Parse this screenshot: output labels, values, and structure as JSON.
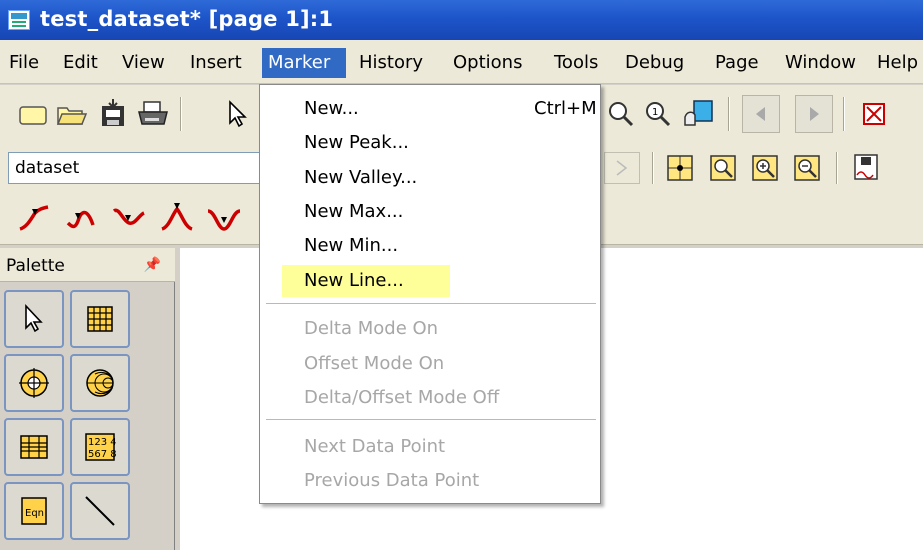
{
  "window": {
    "title": "test_dataset* [page 1]:1"
  },
  "menubar": {
    "items": [
      "File",
      "Edit",
      "View",
      "Insert",
      "Marker",
      "History",
      "Options",
      "Tools",
      "Debug",
      "Page",
      "Window",
      "Help"
    ],
    "active": "Marker"
  },
  "toolbar": {
    "dataset_value": "dataset"
  },
  "palette": {
    "title": "Palette"
  },
  "marker_menu": {
    "items": [
      {
        "label": "New...",
        "shortcut": "Ctrl+M",
        "enabled": true
      },
      {
        "label": "New Peak...",
        "enabled": true
      },
      {
        "label": "New Valley...",
        "enabled": true
      },
      {
        "label": "New Max...",
        "enabled": true
      },
      {
        "label": "New Min...",
        "enabled": true
      },
      {
        "label": "New Line...",
        "enabled": true,
        "highlighted": true
      },
      {
        "label": "Delta Mode On",
        "enabled": false
      },
      {
        "label": "Offset Mode On",
        "enabled": false
      },
      {
        "label": "Delta/Offset Mode Off",
        "enabled": false
      },
      {
        "label": "Next Data Point",
        "enabled": false
      },
      {
        "label": "Previous Data Point",
        "enabled": false
      }
    ]
  },
  "icons": {
    "toolbar1": [
      "new-file-icon",
      "open-folder-icon",
      "save-icon",
      "print-icon",
      "pointer-icon",
      "zoom-fit-icon",
      "zoom-in-icon",
      "pan-icon",
      "back-icon",
      "forward-icon",
      "stop-icon"
    ],
    "toolbar2": [
      "grid-marker-icon",
      "zoom-box-icon",
      "zoom-in-box-icon",
      "zoom-out-box-icon",
      "chart-export-icon"
    ],
    "toolbar3": [
      "marker-peak-icon",
      "marker-valley-icon",
      "marker-max-icon",
      "marker-min-icon",
      "marker-line-icon"
    ],
    "palette": [
      "palette-pointer-icon",
      "palette-table-icon",
      "palette-polar-icon",
      "palette-smith-icon",
      "palette-grid-icon",
      "palette-numbers-icon",
      "palette-equation-icon",
      "palette-line-icon"
    ]
  },
  "palette_labels": {
    "numbers": "123 4\n567 8",
    "equation": "Eqn"
  },
  "colors": {
    "titlebar": "#1d55c9",
    "menu_highlight": "#316ac5",
    "item_highlight": "#ffff99",
    "marker_red": "#cc0000",
    "palette_border": "#7a95c2"
  }
}
